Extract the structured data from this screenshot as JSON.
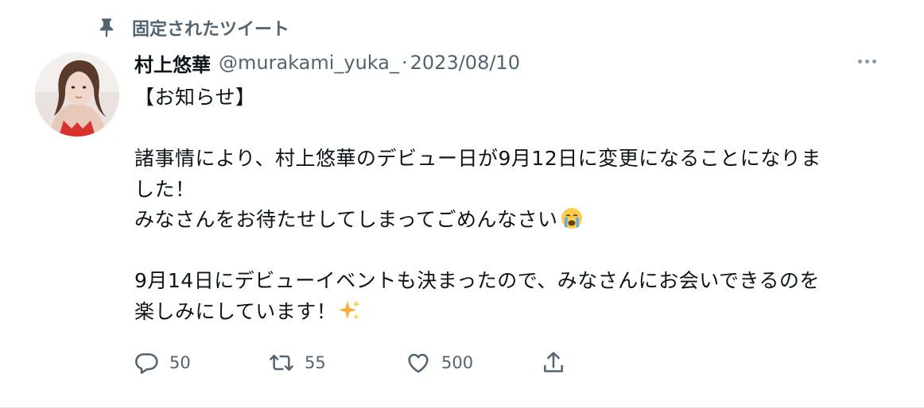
{
  "pinned": {
    "label": "固定されたツイート",
    "icon": "pin-icon"
  },
  "author": {
    "name": "村上悠華",
    "handle": "@murakami_yuka_",
    "separator": "·",
    "date": "2023/08/10"
  },
  "tweet": {
    "lines": [
      "【お知らせ】",
      "",
      "諸事情により、村上悠華のデビュー日が9月12日に変更になることになりま",
      "した！",
      "みなさんをお待たせしてしまってごめんなさい",
      "",
      "9月14日にデビューイベントも決まったので、みなさんにお会いできるのを",
      "楽しみにしています！"
    ],
    "emojis": {
      "crying": "crying-face-emoji",
      "sparkles": "sparkles-emoji"
    }
  },
  "actions": {
    "replies": "50",
    "retweets": "55",
    "likes": "500"
  },
  "colors": {
    "text": "#0f1419",
    "secondary": "#536471",
    "border": "#e6e9ec"
  }
}
